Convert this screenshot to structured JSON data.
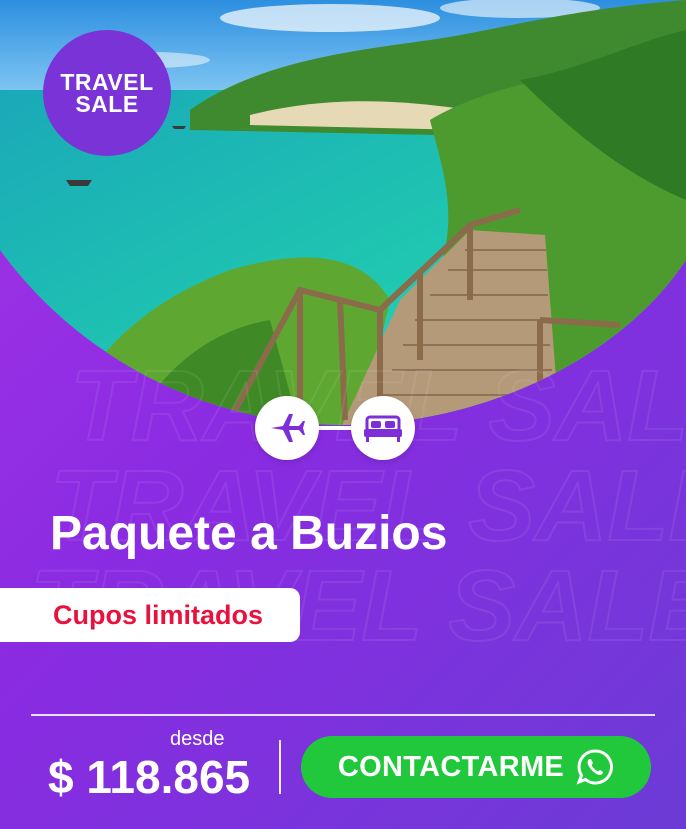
{
  "badge": {
    "line1": "TRAVEL",
    "line2": "SALE"
  },
  "watermark": {
    "text": "TRAVEL SALE"
  },
  "icons": {
    "transport": "airplane-icon",
    "lodging": "bed-icon",
    "contact": "whatsapp-icon"
  },
  "title": "Paquete a Buzios",
  "availability": "Cupos limitados",
  "price": {
    "prefix": "desde",
    "amount": "$ 118.865"
  },
  "cta": {
    "label": "CONTACTARME"
  },
  "colors": {
    "brand_purple": "#8a2be2",
    "badge_purple": "#7a33d6",
    "alert_red": "#e8123f",
    "cta_green": "#21c83c"
  }
}
